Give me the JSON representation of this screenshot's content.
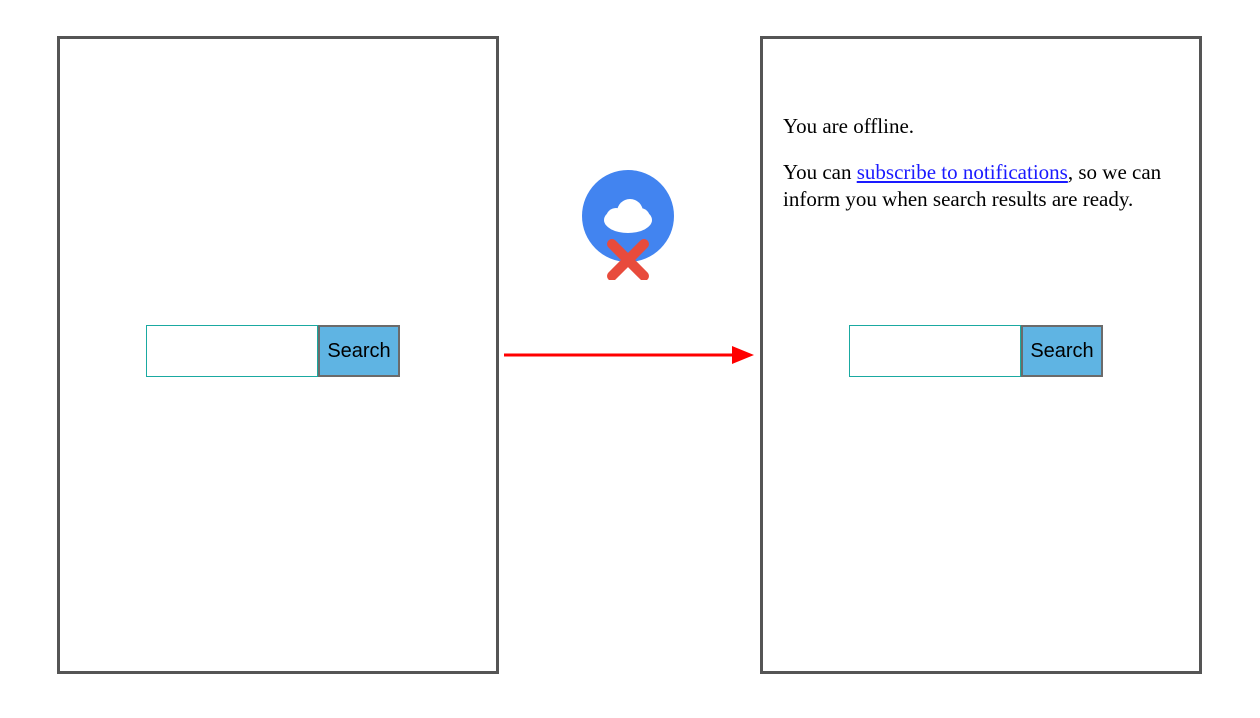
{
  "left": {
    "search_label": "Search"
  },
  "right": {
    "search_label": "Search",
    "offline_msg": "You are offline.",
    "sub_pre": "You can ",
    "sub_link": "subscribe to notifications",
    "sub_post": ", so we can inform you when search results are ready."
  },
  "icons": {
    "offline_cloud": "offline-cloud-icon",
    "arrow": "transition-arrow-icon"
  }
}
